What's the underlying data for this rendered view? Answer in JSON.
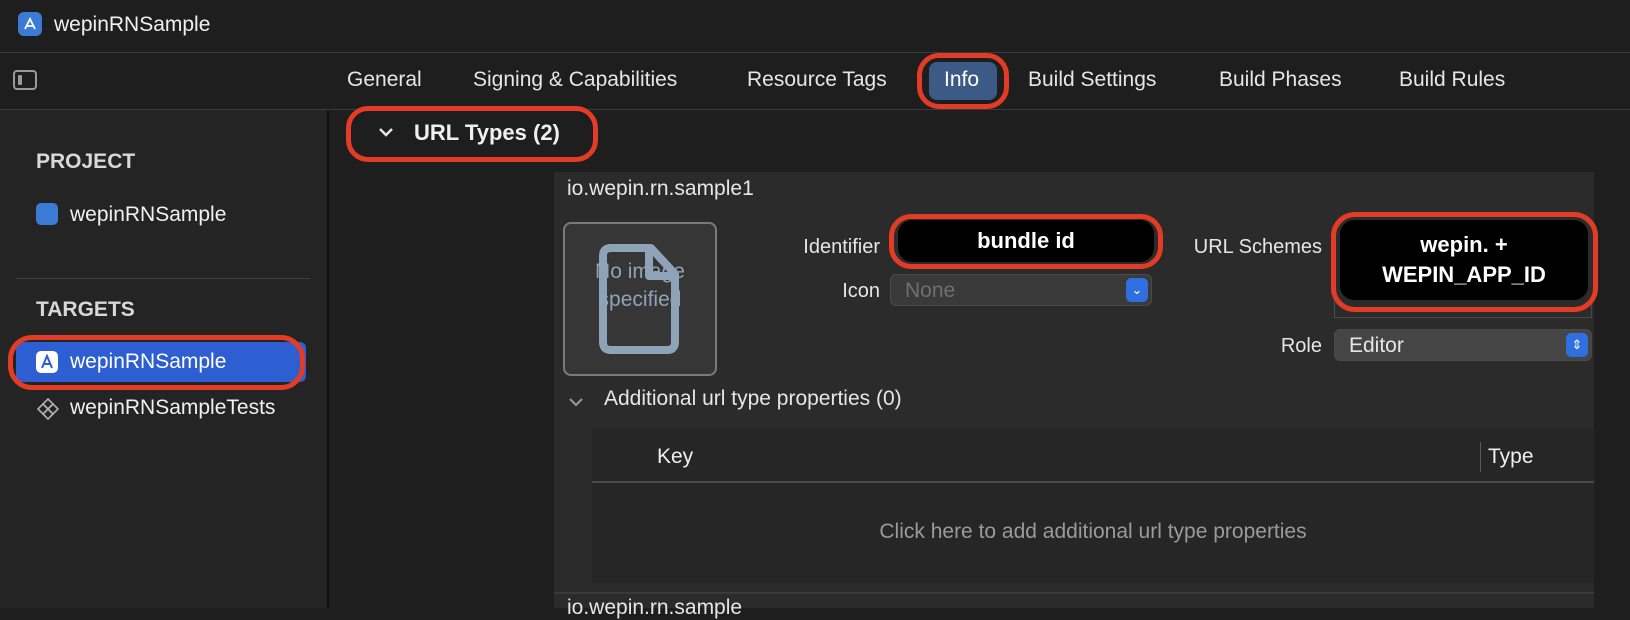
{
  "window": {
    "title": "wepinRNSample"
  },
  "tabs": [
    "General",
    "Signing & Capabilities",
    "Resource Tags",
    "Info",
    "Build Settings",
    "Build Phases",
    "Build Rules"
  ],
  "sidebar": {
    "project_header": "PROJECT",
    "project_item": "wepinRNSample",
    "targets_header": "TARGETS",
    "targets": [
      "wepinRNSample",
      "wepinRNSampleTests"
    ]
  },
  "url_types": {
    "section_title": "URL Types (2)",
    "entry_title": "io.wepin.rn.sample1",
    "no_image_text": "No image specified",
    "identifier_label": "Identifier",
    "identifier_value": "bundle id",
    "icon_label": "Icon",
    "icon_placeholder": "None",
    "url_schemes_label": "URL Schemes",
    "url_schemes_value": "wepin. + WEPIN_APP_ID",
    "role_label": "Role",
    "role_value": "Editor",
    "additional_title": "Additional url type properties (0)",
    "table": {
      "key_header": "Key",
      "type_header": "Type",
      "empty_text": "Click here to add additional url type properties"
    },
    "next_entry_title": "io.wepin.rn.sample"
  },
  "colors": {
    "accent_selection": "#2d5fd3",
    "annotation_red": "#e23b26",
    "tab_selected": "#3d5a86"
  },
  "icons": [
    "xcode-app-icon",
    "sidebar-toggle-icon",
    "chevron-down-icon",
    "document-icon",
    "popup-chevron-icon",
    "test-target-icon"
  ]
}
